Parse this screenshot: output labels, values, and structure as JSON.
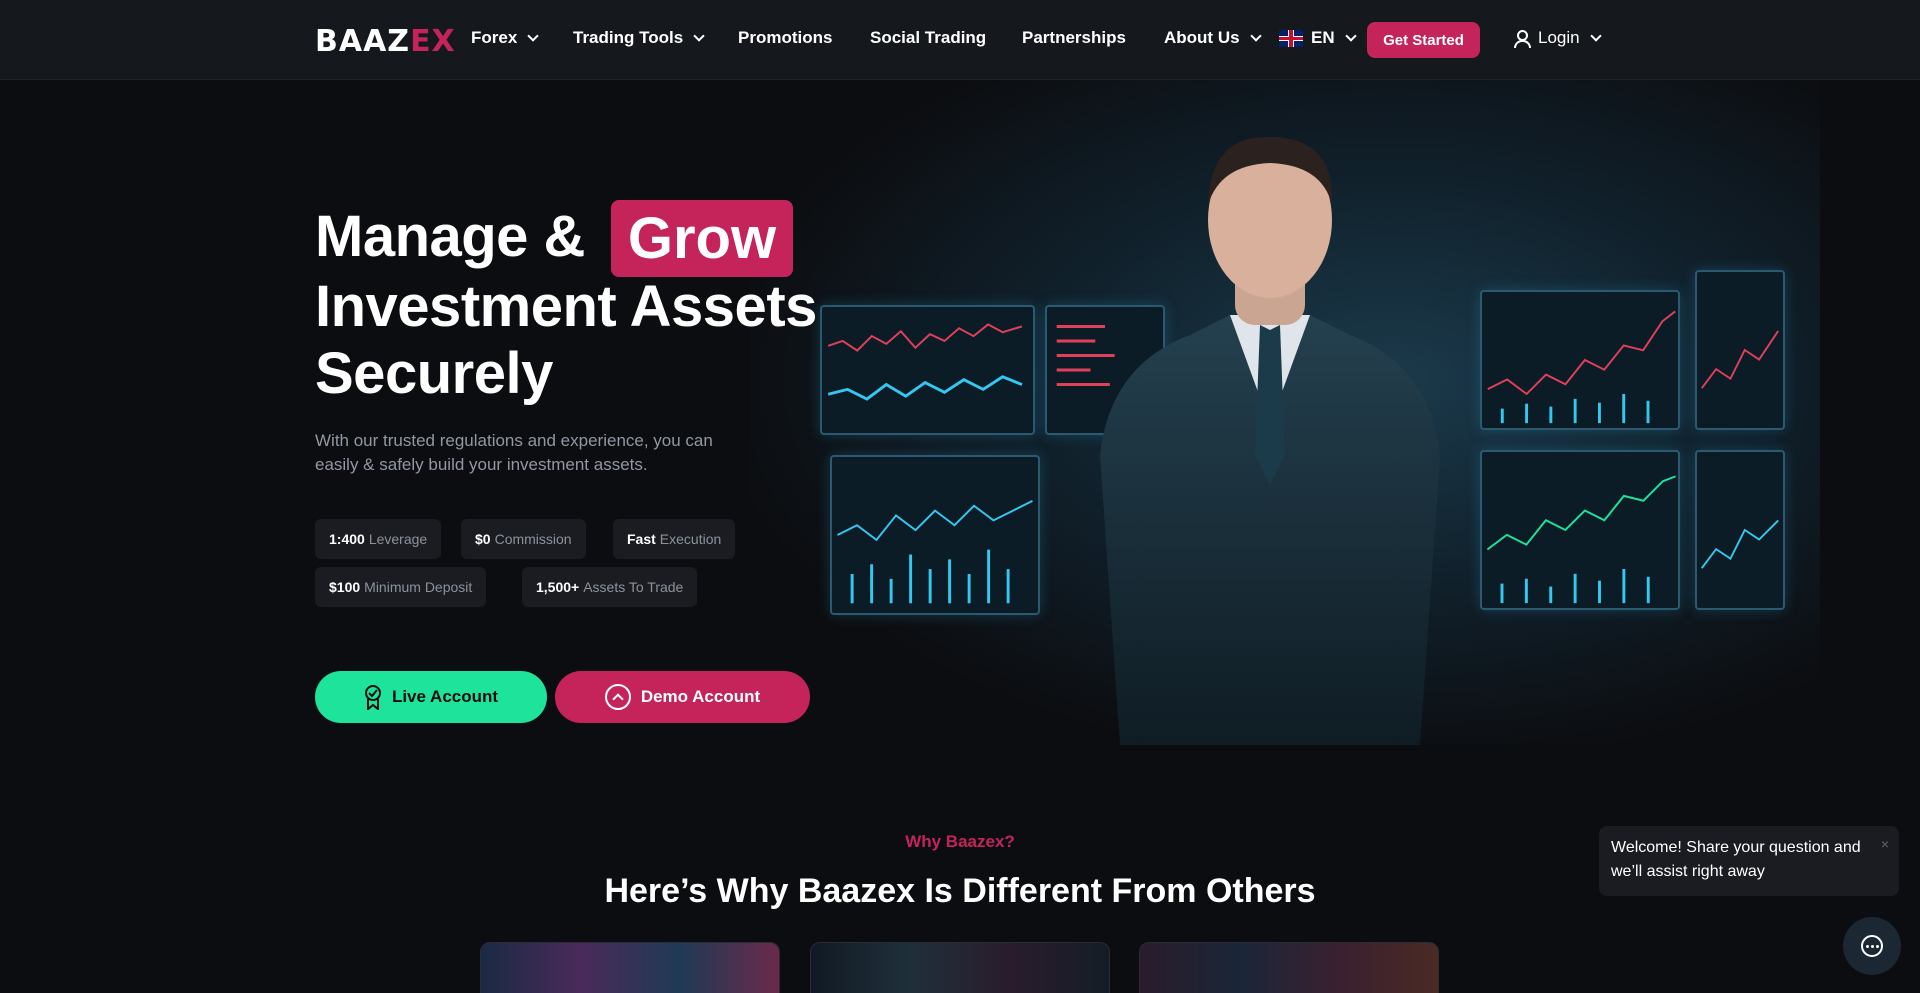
{
  "brand": {
    "logo_white": "BAAZ",
    "logo_red": "EX"
  },
  "nav": {
    "items": [
      {
        "label": "Forex",
        "has_dropdown": true
      },
      {
        "label": "Trading Tools",
        "has_dropdown": true
      },
      {
        "label": "Promotions",
        "has_dropdown": false
      },
      {
        "label": "Social Trading",
        "has_dropdown": false
      },
      {
        "label": "Partnerships",
        "has_dropdown": false
      },
      {
        "label": "About Us",
        "has_dropdown": true
      }
    ],
    "language": "EN",
    "get_started": "Get Started",
    "login": "Login"
  },
  "hero": {
    "title_line1": "Manage &",
    "title_highlight": "Grow",
    "title_line2": "Investment Assets",
    "title_line3": "Securely",
    "subtitle": "With our trusted regulations and experience, you can easily & safely build your investment assets.",
    "features": [
      {
        "key": "1:400",
        "value": "Leverage"
      },
      {
        "key": "$0",
        "value": "Commission"
      },
      {
        "key": "Fast",
        "value": "Execution"
      },
      {
        "key": "$100",
        "value": "Minimum Deposit"
      },
      {
        "key": "1,500+",
        "value": "Assets To Trade"
      }
    ],
    "live_button": "Live Account",
    "demo_button": "Demo Account"
  },
  "why": {
    "eyebrow": "Why Baazex?",
    "heading": "Here’s Why Baazex Is Different From Others"
  },
  "chat": {
    "welcome": "Welcome! Share your question and we’ll assist right away",
    "close": "×"
  },
  "colors": {
    "accent": "#c4245a",
    "green": "#1de39b",
    "background": "#0c0d10",
    "nav_bg": "#15181d"
  }
}
